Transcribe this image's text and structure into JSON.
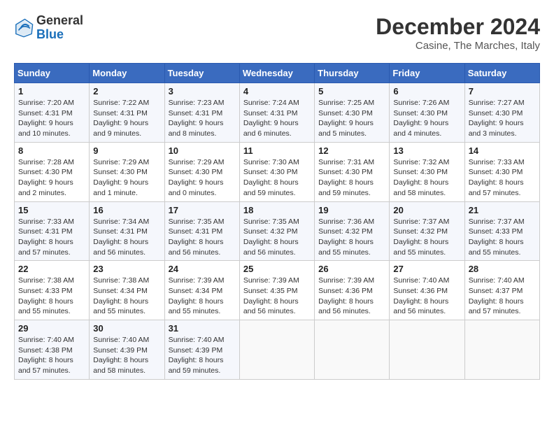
{
  "header": {
    "logo_general": "General",
    "logo_blue": "Blue",
    "month_title": "December 2024",
    "location": "Casine, The Marches, Italy"
  },
  "days_of_week": [
    "Sunday",
    "Monday",
    "Tuesday",
    "Wednesday",
    "Thursday",
    "Friday",
    "Saturday"
  ],
  "weeks": [
    [
      {
        "day": "1",
        "sunrise": "7:20 AM",
        "sunset": "4:31 PM",
        "daylight": "9 hours and 10 minutes."
      },
      {
        "day": "2",
        "sunrise": "7:22 AM",
        "sunset": "4:31 PM",
        "daylight": "9 hours and 9 minutes."
      },
      {
        "day": "3",
        "sunrise": "7:23 AM",
        "sunset": "4:31 PM",
        "daylight": "9 hours and 8 minutes."
      },
      {
        "day": "4",
        "sunrise": "7:24 AM",
        "sunset": "4:31 PM",
        "daylight": "9 hours and 6 minutes."
      },
      {
        "day": "5",
        "sunrise": "7:25 AM",
        "sunset": "4:30 PM",
        "daylight": "9 hours and 5 minutes."
      },
      {
        "day": "6",
        "sunrise": "7:26 AM",
        "sunset": "4:30 PM",
        "daylight": "9 hours and 4 minutes."
      },
      {
        "day": "7",
        "sunrise": "7:27 AM",
        "sunset": "4:30 PM",
        "daylight": "9 hours and 3 minutes."
      }
    ],
    [
      {
        "day": "8",
        "sunrise": "7:28 AM",
        "sunset": "4:30 PM",
        "daylight": "9 hours and 2 minutes."
      },
      {
        "day": "9",
        "sunrise": "7:29 AM",
        "sunset": "4:30 PM",
        "daylight": "9 hours and 1 minute."
      },
      {
        "day": "10",
        "sunrise": "7:29 AM",
        "sunset": "4:30 PM",
        "daylight": "9 hours and 0 minutes."
      },
      {
        "day": "11",
        "sunrise": "7:30 AM",
        "sunset": "4:30 PM",
        "daylight": "8 hours and 59 minutes."
      },
      {
        "day": "12",
        "sunrise": "7:31 AM",
        "sunset": "4:30 PM",
        "daylight": "8 hours and 59 minutes."
      },
      {
        "day": "13",
        "sunrise": "7:32 AM",
        "sunset": "4:30 PM",
        "daylight": "8 hours and 58 minutes."
      },
      {
        "day": "14",
        "sunrise": "7:33 AM",
        "sunset": "4:30 PM",
        "daylight": "8 hours and 57 minutes."
      }
    ],
    [
      {
        "day": "15",
        "sunrise": "7:33 AM",
        "sunset": "4:31 PM",
        "daylight": "8 hours and 57 minutes."
      },
      {
        "day": "16",
        "sunrise": "7:34 AM",
        "sunset": "4:31 PM",
        "daylight": "8 hours and 56 minutes."
      },
      {
        "day": "17",
        "sunrise": "7:35 AM",
        "sunset": "4:31 PM",
        "daylight": "8 hours and 56 minutes."
      },
      {
        "day": "18",
        "sunrise": "7:35 AM",
        "sunset": "4:32 PM",
        "daylight": "8 hours and 56 minutes."
      },
      {
        "day": "19",
        "sunrise": "7:36 AM",
        "sunset": "4:32 PM",
        "daylight": "8 hours and 55 minutes."
      },
      {
        "day": "20",
        "sunrise": "7:37 AM",
        "sunset": "4:32 PM",
        "daylight": "8 hours and 55 minutes."
      },
      {
        "day": "21",
        "sunrise": "7:37 AM",
        "sunset": "4:33 PM",
        "daylight": "8 hours and 55 minutes."
      }
    ],
    [
      {
        "day": "22",
        "sunrise": "7:38 AM",
        "sunset": "4:33 PM",
        "daylight": "8 hours and 55 minutes."
      },
      {
        "day": "23",
        "sunrise": "7:38 AM",
        "sunset": "4:34 PM",
        "daylight": "8 hours and 55 minutes."
      },
      {
        "day": "24",
        "sunrise": "7:39 AM",
        "sunset": "4:34 PM",
        "daylight": "8 hours and 55 minutes."
      },
      {
        "day": "25",
        "sunrise": "7:39 AM",
        "sunset": "4:35 PM",
        "daylight": "8 hours and 56 minutes."
      },
      {
        "day": "26",
        "sunrise": "7:39 AM",
        "sunset": "4:36 PM",
        "daylight": "8 hours and 56 minutes."
      },
      {
        "day": "27",
        "sunrise": "7:40 AM",
        "sunset": "4:36 PM",
        "daylight": "8 hours and 56 minutes."
      },
      {
        "day": "28",
        "sunrise": "7:40 AM",
        "sunset": "4:37 PM",
        "daylight": "8 hours and 57 minutes."
      }
    ],
    [
      {
        "day": "29",
        "sunrise": "7:40 AM",
        "sunset": "4:38 PM",
        "daylight": "8 hours and 57 minutes."
      },
      {
        "day": "30",
        "sunrise": "7:40 AM",
        "sunset": "4:39 PM",
        "daylight": "8 hours and 58 minutes."
      },
      {
        "day": "31",
        "sunrise": "7:40 AM",
        "sunset": "4:39 PM",
        "daylight": "8 hours and 59 minutes."
      },
      null,
      null,
      null,
      null
    ]
  ]
}
